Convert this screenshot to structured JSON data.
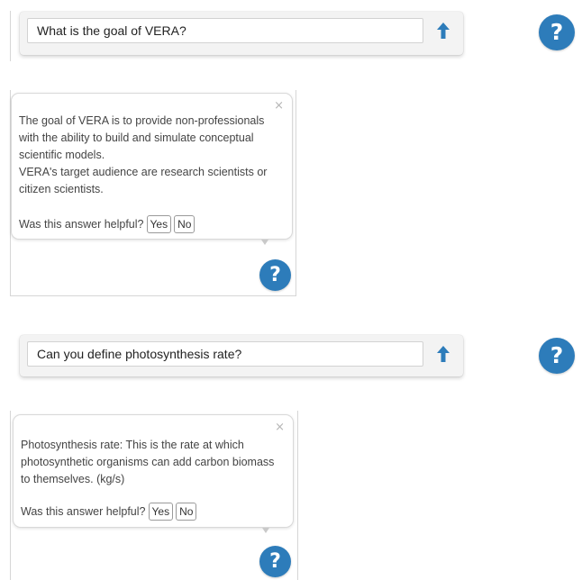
{
  "help_icon": {
    "glyph": "?",
    "color": "#2d7cba"
  },
  "submit_icon": "arrow-up-icon",
  "close_glyph": "×",
  "exchanges": [
    {
      "question": "What is the goal of VERA?",
      "answer": "The goal of VERA is to provide non-professionals\nwith the ability to build and simulate conceptual\nscientific models.\nVERA's target audience are research scientists or\ncitizen scientists.",
      "helpful_prompt": "Was this answer helpful?",
      "yes_label": "Yes",
      "no_label": "No"
    },
    {
      "question": "Can you define photosynthesis rate?",
      "answer": "Photosynthesis rate: This is the rate at which\nphotosynthetic organisms can add carbon biomass\nto themselves. (kg/s)",
      "helpful_prompt": "Was this answer helpful?",
      "yes_label": "Yes",
      "no_label": "No"
    }
  ]
}
